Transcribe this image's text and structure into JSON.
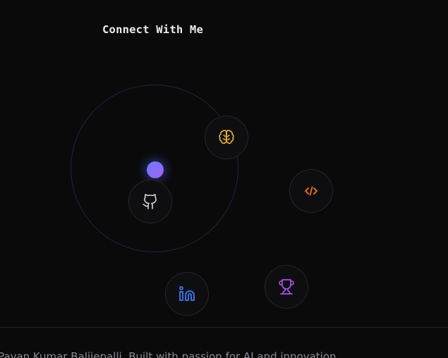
{
  "section": {
    "heading": "Connect With Me"
  },
  "nodes": [
    {
      "name": "brain",
      "icon": "brain-icon",
      "color": "#e9b23a"
    },
    {
      "name": "code",
      "icon": "code-icon",
      "color": "#e06a2a"
    },
    {
      "name": "github",
      "icon": "github-icon",
      "color": "#d8d8dc"
    },
    {
      "name": "linkedin",
      "icon": "linkedin-icon",
      "color": "#3a6fe0"
    },
    {
      "name": "trophy",
      "icon": "trophy-icon",
      "color": "#a552e6"
    }
  ],
  "colors": {
    "background": "#0a0a0b",
    "orbit": "#1d2740",
    "center_dot": "#7b74f7"
  },
  "footer": {
    "text": "Pavan Kumar Balijepalli. Built with passion for AI and innovation."
  }
}
